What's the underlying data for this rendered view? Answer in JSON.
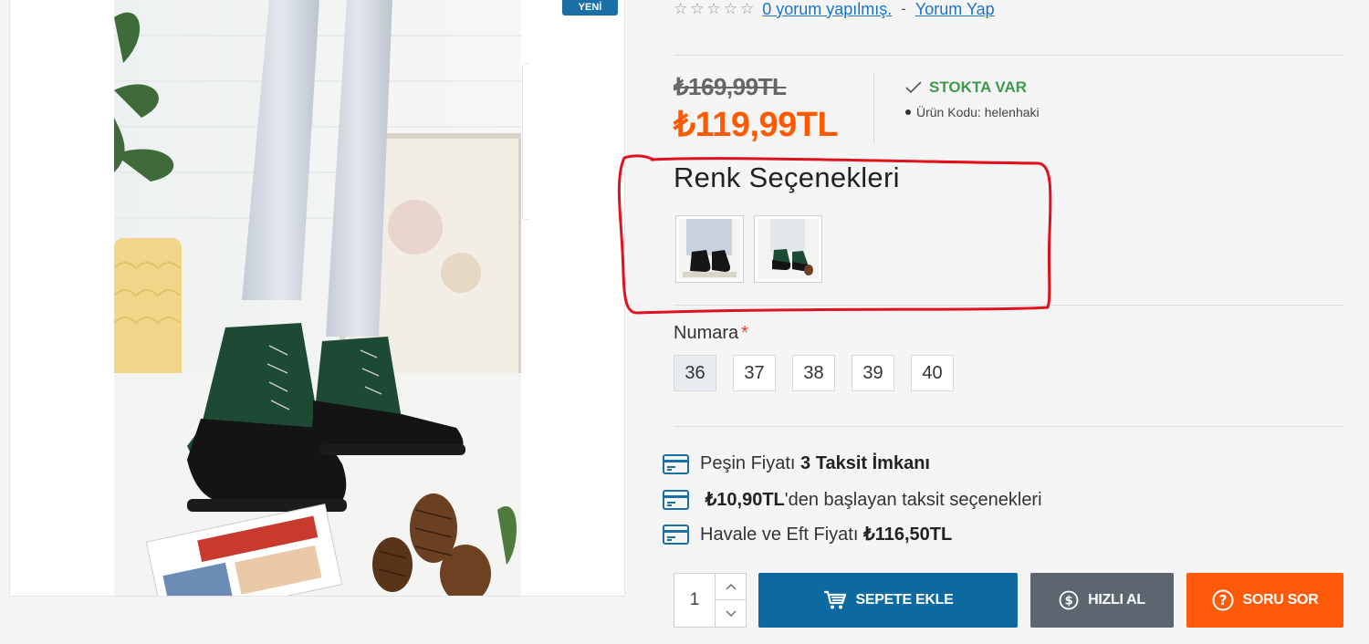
{
  "product": {
    "badge": "YENİ",
    "rating": {
      "stars": "☆☆☆☆☆",
      "review_count_link": "0 yorum yapılmış.",
      "separator": "-",
      "write_review_link": "Yorum Yap"
    },
    "price": {
      "old": "₺169,99TL",
      "current": "₺119,99TL"
    },
    "stock_status": "STOKTA VAR",
    "product_code": "Ürün Kodu: helenhaki",
    "color_options": {
      "title": "Renk Seçenekleri",
      "swatches": [
        "black-boot-variant",
        "green-boot-variant"
      ]
    },
    "size": {
      "label": "Numara",
      "required_mark": "*",
      "options": [
        "36",
        "37",
        "38",
        "39",
        "40"
      ],
      "selected": "36"
    },
    "payment_info": {
      "installment_prefix": "Peşin Fiyatı",
      "installment_bold": "3 Taksit İmkanı",
      "installment_from_bold": "₺10,90TL",
      "installment_from_suffix": "'den başlayan taksit seçenekleri",
      "transfer_prefix": "Havale ve Eft Fiyatı",
      "transfer_bold": "₺116,50TL"
    },
    "purchase": {
      "quantity": "1",
      "add_to_cart": "SEPETE EKLE",
      "quick_buy": "HIZLI AL",
      "ask_question": "SORU SOR"
    }
  },
  "colors": {
    "accent_blue": "#0d6aa1",
    "quick_gray": "#5b6670",
    "orange": "#ff5a0a",
    "price_orange": "#ff5a00",
    "stock_green": "#3c9a4a",
    "annotation_red": "#e0121e",
    "link_blue": "#1a73c8"
  },
  "icons": [
    "star-outline-icon",
    "check-icon",
    "credit-card-icon",
    "cart-icon",
    "dollar-circle-icon",
    "question-circle-icon",
    "chevron-up-icon",
    "chevron-down-icon"
  ]
}
